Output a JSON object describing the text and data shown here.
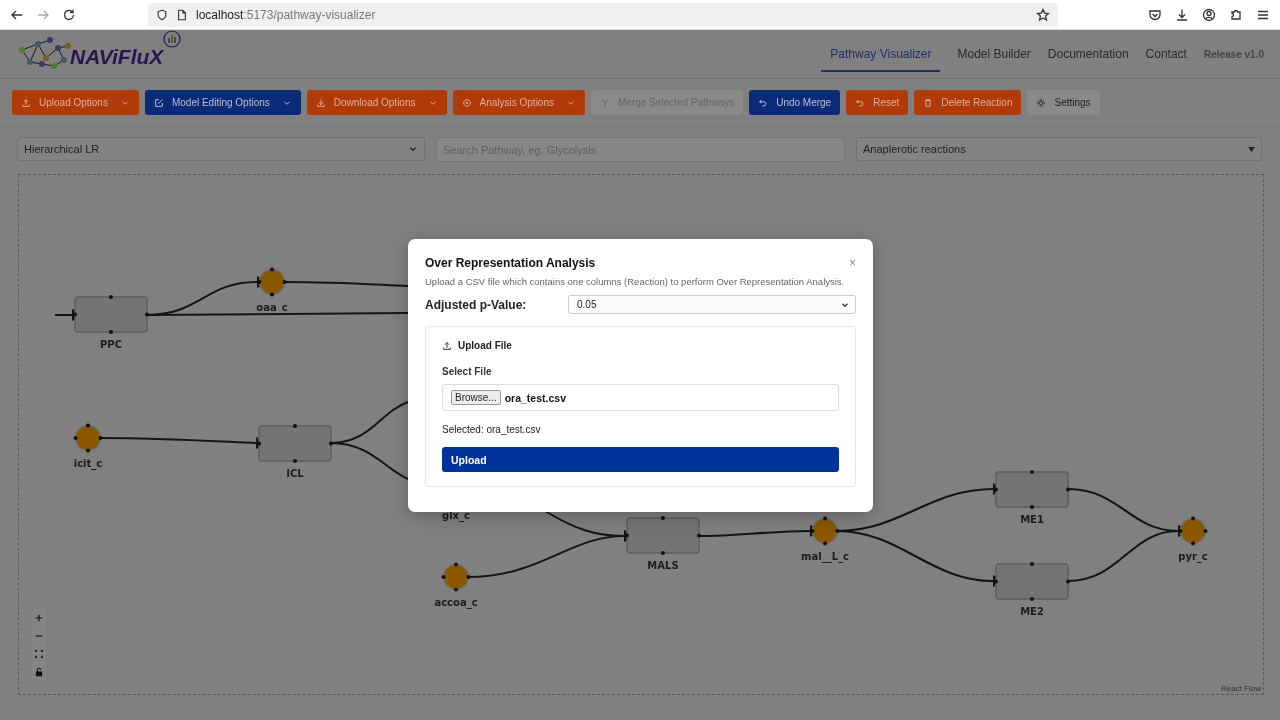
{
  "browser": {
    "url": "**localhost**:5173/pathway-visualizer"
  },
  "header": {
    "logo": "NAViFluX",
    "nav": [
      {
        "label": "Pathway Visualizer",
        "selected": true
      },
      {
        "label": "Model Builder",
        "selected": false
      },
      {
        "label": "Documentation",
        "selected": false
      },
      {
        "label": "Contact",
        "selected": false
      }
    ],
    "release": "Release v1.0"
  },
  "toolbar": [
    {
      "label": "Upload Options",
      "kind": "accent",
      "dropdown": true,
      "disabled": false
    },
    {
      "label": "Model Editing Options",
      "kind": "primary",
      "dropdown": true,
      "disabled": false
    },
    {
      "label": "Download Options",
      "kind": "accent",
      "dropdown": true,
      "disabled": false
    },
    {
      "label": "Analysis Options",
      "kind": "accent",
      "dropdown": true,
      "disabled": false
    },
    {
      "label": "Merge Selected Pathways",
      "kind": "neutral",
      "dropdown": false,
      "disabled": true
    },
    {
      "label": "Undo Merge",
      "kind": "primary",
      "dropdown": false,
      "disabled": false
    },
    {
      "label": "Reset",
      "kind": "accent",
      "dropdown": false,
      "disabled": false
    },
    {
      "label": "Delete Reaction",
      "kind": "accent",
      "dropdown": false,
      "disabled": false
    },
    {
      "label": "Settings",
      "kind": "neutral",
      "dropdown": false,
      "disabled": false
    }
  ],
  "controls": {
    "layout": "Hierarchical LR",
    "search": {
      "placeholder": "Search Pathway, eg. Glycolysis"
    },
    "pathway": "Anaplerotic reactions"
  },
  "graph": {
    "nodes": [
      {
        "kind": "reaction",
        "label": "PPC"
      },
      {
        "kind": "metabolite",
        "label": "oaa_c"
      },
      {
        "kind": "metabolite",
        "label": "icit_c"
      },
      {
        "kind": "reaction",
        "label": "ICL"
      },
      {
        "kind": "label",
        "label": "glx_c"
      },
      {
        "kind": "reaction",
        "label": "MALS"
      },
      {
        "kind": "metabolite",
        "label": "accoa_c"
      },
      {
        "kind": "metabolite",
        "label": "mal__L_c"
      },
      {
        "kind": "reaction",
        "label": "ME1"
      },
      {
        "kind": "reaction",
        "label": "ME2"
      },
      {
        "kind": "metabolite",
        "label": "pyr_c"
      }
    ],
    "attribution": "React Flow"
  },
  "modal": {
    "title": "Over Representation Analysis",
    "close": "×",
    "description": "Upload a CSV file which contains one columns (Reaction) to perform Over Representation Analysis.",
    "p_label": "Adjusted p-Value:",
    "p_value": "0.05",
    "card_title": "Upload File",
    "file_label": "Select File",
    "browse": "Browse...",
    "file_name": "ora_test.csv",
    "selected": "Selected: ora_test.csv",
    "upload": "Upload"
  }
}
